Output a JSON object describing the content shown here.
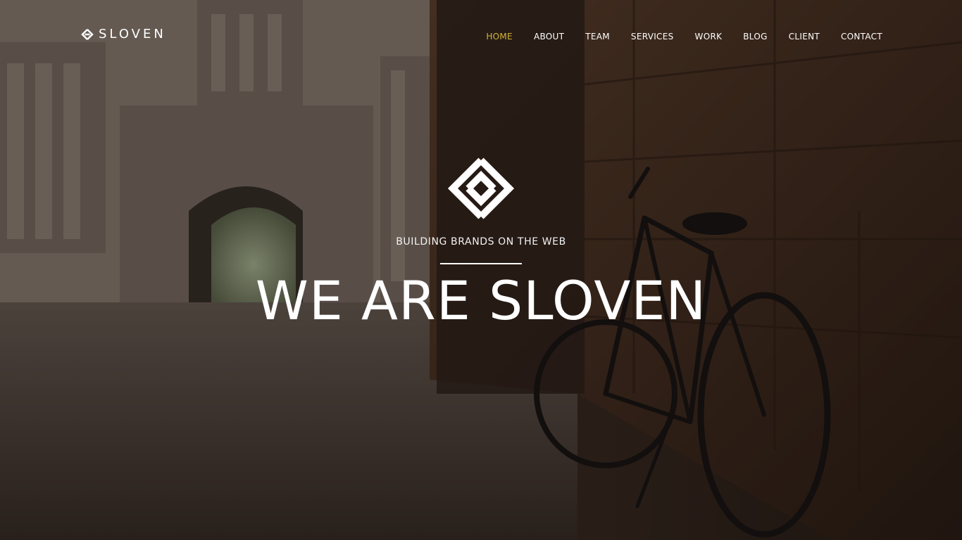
{
  "brand": {
    "name": "SLOVEN",
    "logo_icon": "diamond-link-icon"
  },
  "nav": {
    "items": [
      {
        "label": "HOME",
        "active": true
      },
      {
        "label": "ABOUT",
        "active": false
      },
      {
        "label": "TEAM",
        "active": false
      },
      {
        "label": "SERVICES",
        "active": false
      },
      {
        "label": "WORK",
        "active": false
      },
      {
        "label": "BLOG",
        "active": false
      },
      {
        "label": "CLIENT",
        "active": false
      },
      {
        "label": "CONTACT",
        "active": false
      }
    ]
  },
  "hero": {
    "logo_icon": "diamond-link-icon",
    "tagline": "BUILDING BRANDS ON THE WEB",
    "headline": "WE ARE SLOVEN",
    "background": "bicycle-against-stone-wall-photo"
  },
  "colors": {
    "accent": "#d4b43a",
    "text": "#ffffff",
    "overlay": "#140e0a"
  }
}
